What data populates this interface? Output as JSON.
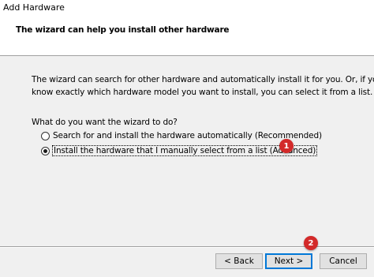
{
  "window": {
    "title": "Add Hardware"
  },
  "header": {
    "heading": "The wizard can help you install other hardware"
  },
  "intro": {
    "lines": [
      "The wizard can search for other hardware and automatically install it for you. Or, if you",
      "know exactly which hardware model you want to install, you can select it from a list."
    ]
  },
  "question": "What do you want the wizard to do?",
  "options": [
    {
      "label": "Search for and install the hardware automatically (Recommended)",
      "selected": false
    },
    {
      "label": "Install the hardware that I manually select from a list (Advanced)",
      "selected": true
    }
  ],
  "annotations": {
    "badge1": "1",
    "badge2": "2",
    "badge_color": "#d32a2a"
  },
  "buttons": {
    "back": "< Back",
    "next": "Next >",
    "cancel": "Cancel"
  },
  "colors": {
    "header_bg": "#ffffff",
    "body_bg": "#f0f0f0",
    "button_bg": "#e1e1e1",
    "default_button_border": "#0078d7"
  }
}
